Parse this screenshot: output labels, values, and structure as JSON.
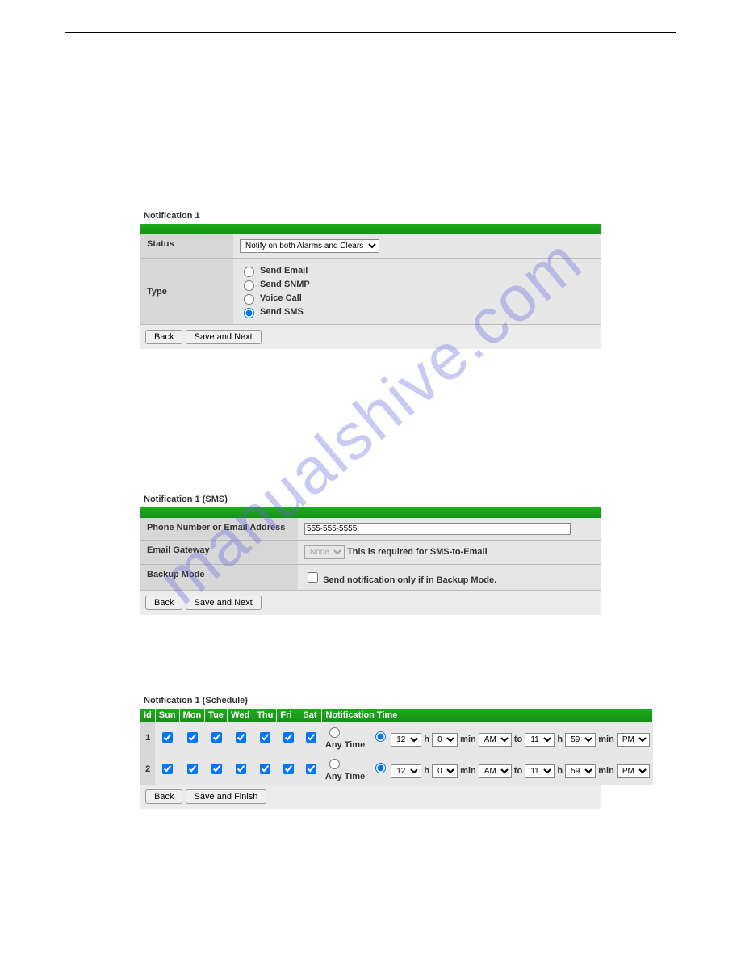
{
  "watermark": "manualshive.com",
  "panel1": {
    "title": "Notification 1",
    "status_label": "Status",
    "status_value": "Notify on both Alarms and Clears",
    "type_label": "Type",
    "type_options": {
      "email": "Send Email",
      "snmp": "Send SNMP",
      "voice": "Voice Call",
      "sms": "Send SMS"
    },
    "back": "Back",
    "save": "Save and Next"
  },
  "panel2": {
    "title": "Notification 1 (SMS)",
    "phone_label": "Phone Number or Email Address",
    "phone_value": "555-555-5555",
    "gateway_label": "Email Gateway",
    "gateway_value": "None",
    "gateway_note": "This is required for SMS-to-Email",
    "backup_label": "Backup Mode",
    "backup_text": "Send notification only if in Backup Mode.",
    "back": "Back",
    "save": "Save and Next"
  },
  "panel3": {
    "title": "Notification 1 (Schedule)",
    "headers": {
      "id": "Id",
      "sun": "Sun",
      "mon": "Mon",
      "tue": "Tue",
      "wed": "Wed",
      "thu": "Thu",
      "fri": "Fri",
      "sat": "Sat",
      "nt": "Notification Time"
    },
    "anytime": "Any Time",
    "time": {
      "h1": "12",
      "m1": "0",
      "ampm1": "AM",
      "to": "to",
      "h2": "11",
      "m2": "59",
      "ampm2": "PM",
      "hlabel": "h",
      "mlabel": "min"
    },
    "rows": {
      "r1": "1",
      "r2": "2"
    },
    "back": "Back",
    "save": "Save and Finish"
  }
}
